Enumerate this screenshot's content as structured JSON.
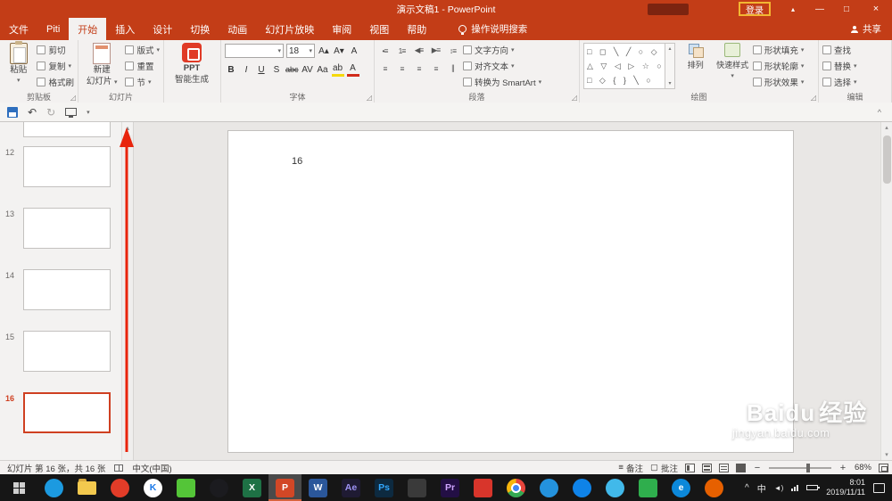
{
  "colors": {
    "titlebar": "#c33d17",
    "ribbon_bg": "#f3f1f0",
    "annotation_red": "#e8240c",
    "selected_slide_border": "#cf4021",
    "taskbar_bg": "#161616",
    "canvas_bg": "#e9e7e5",
    "signin_highlight": "#f2b632"
  },
  "titlebar": {
    "title": "演示文稿1 - PowerPoint",
    "sign_in": "登录",
    "minimize": "—",
    "maximize": "□",
    "close": "×"
  },
  "tabs": {
    "list": [
      "文件",
      "Piti",
      "开始",
      "插入",
      "设计",
      "切换",
      "动画",
      "幻灯片放映",
      "审阅",
      "视图",
      "帮助"
    ],
    "selected": "开始",
    "tell_me": "操作说明搜索",
    "share": "共享"
  },
  "ribbon": {
    "clipboard": {
      "label": "剪贴板",
      "paste": "粘贴",
      "cut": "剪切",
      "copy": "复制",
      "format_painter": "格式刷"
    },
    "slides": {
      "label": "幻灯片",
      "new_slide_line1": "新建",
      "new_slide_line2": "幻灯片",
      "layout": "版式",
      "reset": "重置",
      "section": "节"
    },
    "ai": {
      "title": "PPT",
      "subtitle": "智能生成"
    },
    "font": {
      "label": "字体",
      "font_name": "",
      "font_size": "18"
    },
    "paragraph": {
      "label": "段落",
      "text_direction": "文字方向",
      "align_text": "对齐文本",
      "smartart": "转换为 SmartArt"
    },
    "drawing": {
      "label": "绘图",
      "arrange": "排列",
      "quick_styles": "快速样式",
      "shape_fill": "形状填充",
      "shape_outline": "形状轮廓",
      "shape_effects": "形状效果"
    },
    "editing": {
      "label": "编辑",
      "find": "查找",
      "replace": "替换",
      "select": "选择"
    }
  },
  "icons": {
    "dropdown": "▾",
    "undo": "↶",
    "redo": "↻",
    "collapse_ribbon": "^",
    "ribbon_display": "▴",
    "bold": "B",
    "italic": "I",
    "underline": "U",
    "strikethrough": "abc",
    "shadow": "S",
    "char_spacing": "AV",
    "change_case": "Aa",
    "highlight": "ab",
    "font_color": "A",
    "grow_font": "A▴",
    "shrink_font": "A▾",
    "clear_format": "A",
    "bullets": "•≡",
    "numbering": "1≡",
    "indent_less": "◀≡",
    "indent_more": "▶≡",
    "line_spacing": "↕≡",
    "align_left": "≡",
    "align_center": "≡",
    "align_right": "≡",
    "justify": "≡",
    "columns": "∥",
    "shapes_row1": "□ ◻ ╲ ╱ ○ ◇",
    "shapes_row2": "△ ▽ ◁ ▷ ☆ ○",
    "shapes_row3": "□ ◇ { } ╲ ○",
    "scroll_up": "▲",
    "small_up": "▴",
    "small_down": "▾",
    "notes": "≡",
    "comments": "▢",
    "volume": "◄)",
    "tray_expand": "^"
  },
  "thumbnails": {
    "items": [
      {
        "num": "12"
      },
      {
        "num": "13"
      },
      {
        "num": "14"
      },
      {
        "num": "15"
      },
      {
        "num": "16",
        "selected": true
      }
    ]
  },
  "slide": {
    "content": "16"
  },
  "watermark": {
    "brand_en": "Baidu",
    "brand_cn": "经验",
    "site": "jingyan.baidu.com"
  },
  "statusbar": {
    "slide_info": "幻灯片 第 16 张，共 16 张",
    "language": "中文(中国)",
    "notes": "备注",
    "comments": "批注",
    "zoom_level": "68%"
  },
  "taskbar": {
    "apps": [
      {
        "name": "browser-globe",
        "label": "",
        "bg": "#1c9ae0",
        "fg": "#ffffff"
      },
      {
        "name": "file-explorer",
        "label": "",
        "bg": "#f3c94e",
        "fg": "#aa8822"
      },
      {
        "name": "security-app",
        "label": "",
        "bg": "#e23c28",
        "fg": "#ffffff"
      },
      {
        "name": "k-music",
        "label": "K",
        "bg": "#ffffff",
        "fg": "#1a78e8"
      },
      {
        "name": "wechat",
        "label": "",
        "bg": "#54c538",
        "fg": "#ffffff"
      },
      {
        "name": "qq",
        "label": "",
        "bg": "#1b1b1f",
        "fg": "#ffffff"
      },
      {
        "name": "excel",
        "label": "X",
        "bg": "#1e7145",
        "fg": "#ffffff"
      },
      {
        "name": "powerpoint",
        "label": "P",
        "bg": "#d24726",
        "fg": "#ffffff",
        "active": true
      },
      {
        "name": "word",
        "label": "W",
        "bg": "#2b579a",
        "fg": "#ffffff"
      },
      {
        "name": "after-effects",
        "label": "Ae",
        "bg": "#1f1b33",
        "fg": "#9f93f5"
      },
      {
        "name": "photoshop",
        "label": "Ps",
        "bg": "#0d2a40",
        "fg": "#31a8ff"
      },
      {
        "name": "video-editor",
        "label": "",
        "bg": "#3a3a3a",
        "fg": "#dddddd"
      },
      {
        "name": "premiere",
        "label": "Pr",
        "bg": "#230f45",
        "fg": "#cfa6ff"
      },
      {
        "name": "media-app",
        "label": "",
        "bg": "#d8352b",
        "fg": "#ffffff"
      },
      {
        "name": "chrome",
        "label": "",
        "bg": "",
        "fg": ""
      },
      {
        "name": "blue-app",
        "label": "",
        "bg": "#2492dd",
        "fg": "#ffffff"
      },
      {
        "name": "thunder",
        "label": "",
        "bg": "#0f83e8",
        "fg": "#ffffff"
      },
      {
        "name": "utility-app",
        "label": "",
        "bg": "#41b9ea",
        "fg": "#ffffff"
      },
      {
        "name": "green-app",
        "label": "",
        "bg": "#2fae4d",
        "fg": "#ffffff"
      },
      {
        "name": "edge",
        "label": "e",
        "bg": "#0c88da",
        "fg": "#ffffff"
      },
      {
        "name": "firefox",
        "label": "",
        "bg": "#e66000",
        "fg": "#ffffff"
      }
    ],
    "tray": {
      "ime": "中",
      "time": "8:01",
      "date": "2019/11/11"
    }
  }
}
